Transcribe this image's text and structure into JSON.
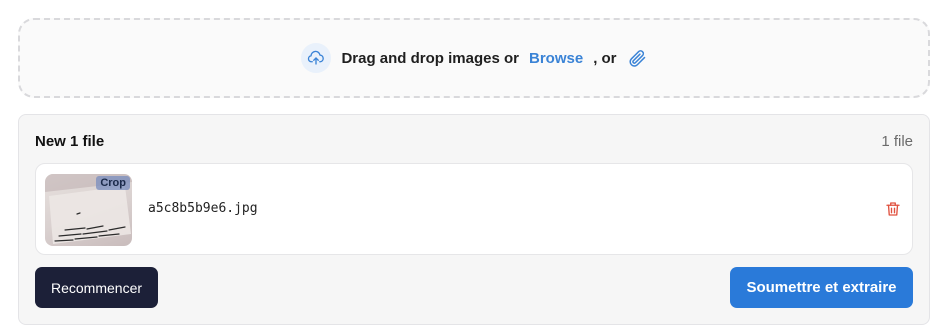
{
  "dropzone": {
    "text_prefix": "Drag and drop images or",
    "browse_link": "Browse",
    "text_suffix": ", or",
    "icons": [
      "cloud-upload-icon",
      "paperclip-icon"
    ]
  },
  "panel": {
    "title": "New 1 file",
    "count": "1 file"
  },
  "files": [
    {
      "name": "a5c8b5b9e6.jpg",
      "badge": "Crop",
      "icon": "trash-icon"
    }
  ],
  "actions": {
    "restart_label": "Recommencer",
    "submit_label": "Soumettre et extraire"
  },
  "colors": {
    "accent": "#2a7ad9",
    "link": "#3a83d6",
    "dark_button": "#1c2038",
    "delete": "#e0513f"
  }
}
